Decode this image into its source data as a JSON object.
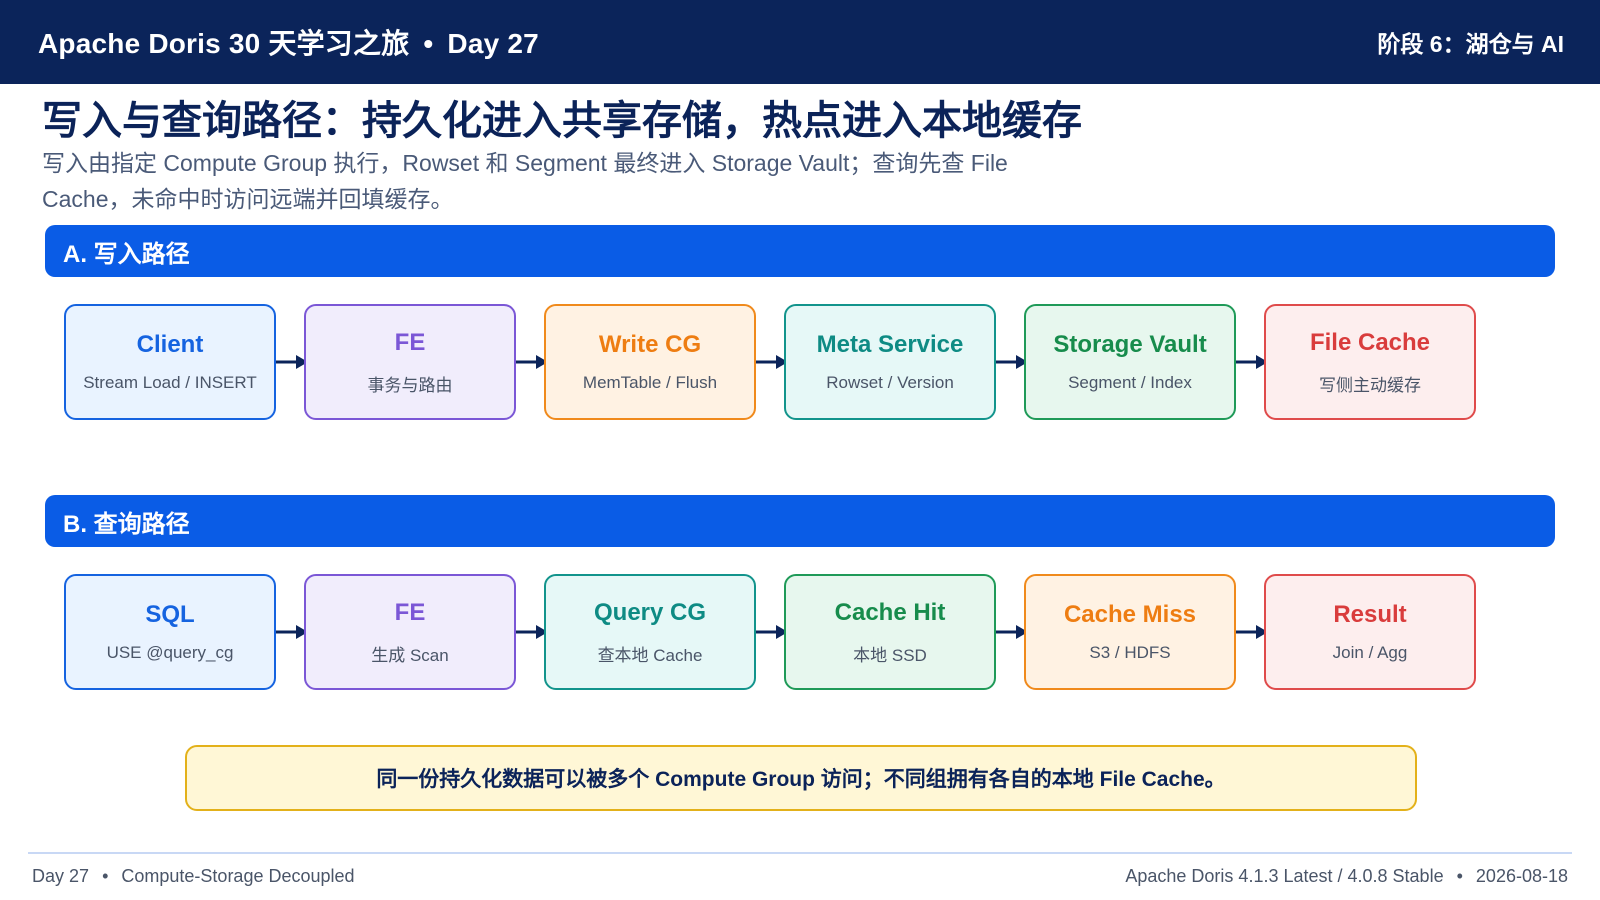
{
  "header": {
    "brand": "Apache Doris 30 天学习之旅",
    "separator": "•",
    "day": "Day 27",
    "stage": "阶段 6：湖仓与 AI"
  },
  "title": "写入与查询路径：持久化进入共享存储，热点进入本地缓存",
  "subtitle": "写入由指定 Compute Group 执行，Rowset 和 Segment 最终进入 Storage Vault；查询先查 File Cache，未命中时访问远端并回填缓存。",
  "section_a": {
    "label": "A. 写入路径",
    "nodes": [
      {
        "title": "Client",
        "sub": "Stream Load / INSERT",
        "color": "blue"
      },
      {
        "title": "FE",
        "sub": "事务与路由",
        "color": "purple"
      },
      {
        "title": "Write CG",
        "sub": "MemTable / Flush",
        "color": "orange"
      },
      {
        "title": "Meta Service",
        "sub": "Rowset / Version",
        "color": "teal"
      },
      {
        "title": "Storage Vault",
        "sub": "Segment / Index",
        "color": "green"
      },
      {
        "title": "File Cache",
        "sub": "写侧主动缓存",
        "color": "red"
      }
    ]
  },
  "section_b": {
    "label": "B. 查询路径",
    "nodes": [
      {
        "title": "SQL",
        "sub": "USE @query_cg",
        "color": "blue"
      },
      {
        "title": "FE",
        "sub": "生成 Scan",
        "color": "purple"
      },
      {
        "title": "Query CG",
        "sub": "查本地 Cache",
        "color": "teal"
      },
      {
        "title": "Cache Hit",
        "sub": "本地 SSD",
        "color": "green"
      },
      {
        "title": "Cache Miss",
        "sub": "S3 / HDFS",
        "color": "orange"
      },
      {
        "title": "Result",
        "sub": "Join / Agg",
        "color": "red"
      }
    ]
  },
  "note": "同一份持久化数据可以被多个 Compute Group 访问；不同组拥有各自的本地 File Cache。",
  "footer": {
    "left_day": "Day 27",
    "left_topic": "Compute-Storage Decoupled",
    "right_version": "Apache Doris 4.1.3 Latest / 4.0.8 Stable",
    "right_date": "2026-08-18",
    "separator": "•"
  },
  "colors": {
    "header_bg": "#0b245a",
    "section_bar": "#0a5ce6",
    "arrow": "#0b245a",
    "note_bg": "#fff7d6",
    "note_border": "#e3b11a"
  }
}
